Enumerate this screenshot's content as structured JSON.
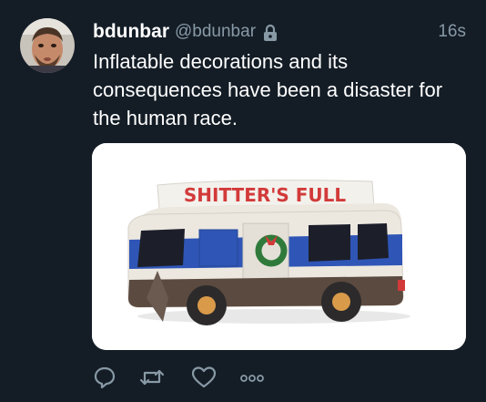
{
  "tweet": {
    "display_name": "bdunbar",
    "handle": "@bdunbar",
    "timestamp": "16s",
    "text": "Inflatable decorations and its consequences have been a disaster for the human race.",
    "protected_icon": "lock-icon"
  },
  "media": {
    "sign_text": "SHITTER'S FULL",
    "subject": "inflatable-rv"
  },
  "actions": [
    {
      "name": "reply",
      "icon": "reply-icon"
    },
    {
      "name": "retweet",
      "icon": "retweet-icon"
    },
    {
      "name": "like",
      "icon": "heart-icon"
    },
    {
      "name": "more",
      "icon": "more-icon"
    }
  ],
  "colors": {
    "background": "#141d26",
    "secondary_text": "#8899a6",
    "primary_text": "#ffffff"
  }
}
